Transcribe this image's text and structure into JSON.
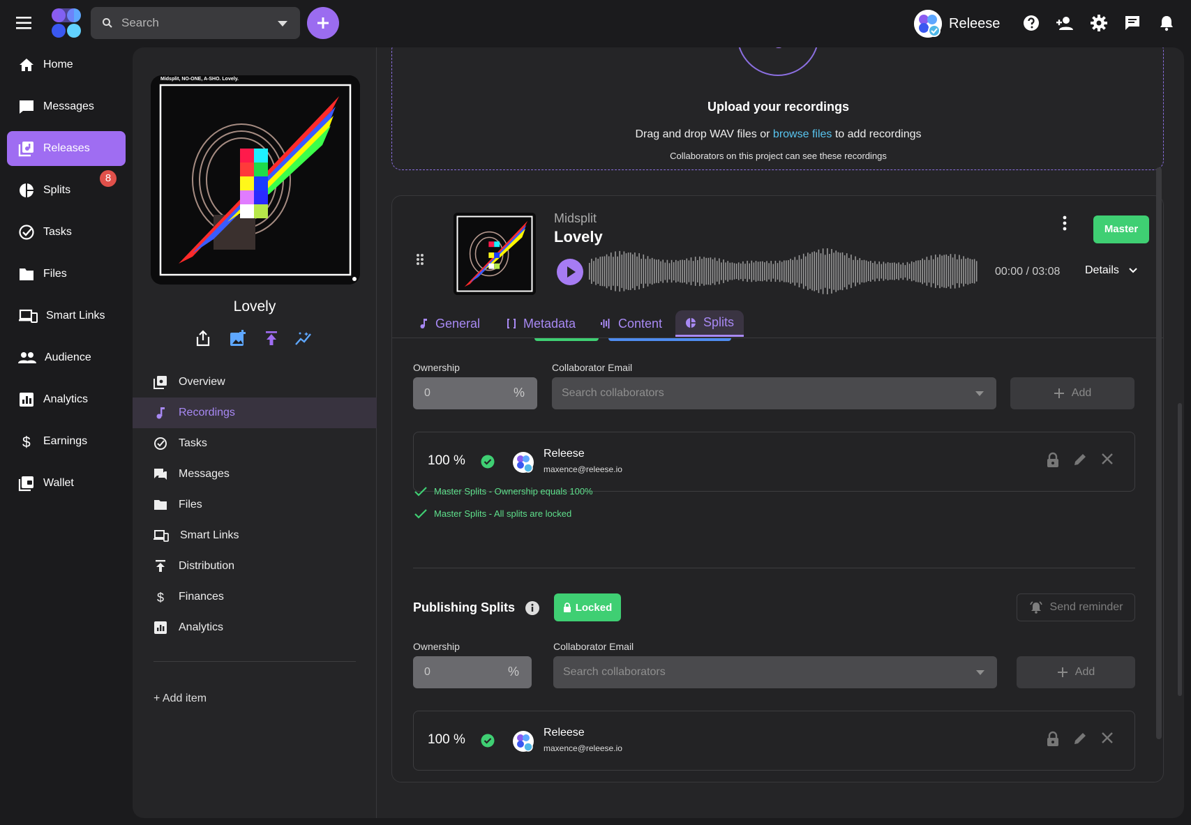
{
  "topbar": {
    "search_placeholder": "Search",
    "user_name": "Releese"
  },
  "sidebar": {
    "items": [
      {
        "label": "Home",
        "icon": "home-icon"
      },
      {
        "label": "Messages",
        "icon": "chat-icon"
      },
      {
        "label": "Releases",
        "icon": "releases-icon",
        "active": true
      },
      {
        "label": "Splits",
        "icon": "pie-chart-icon",
        "badge": "8"
      },
      {
        "label": "Tasks",
        "icon": "check-circle-icon"
      },
      {
        "label": "Files",
        "icon": "folder-icon"
      },
      {
        "label": "Smart Links",
        "icon": "devices-icon"
      },
      {
        "label": "Audience",
        "icon": "people-icon"
      },
      {
        "label": "Analytics",
        "icon": "analytics-icon"
      },
      {
        "label": "Earnings",
        "icon": "dollar-icon"
      },
      {
        "label": "Wallet",
        "icon": "wallet-icon"
      }
    ]
  },
  "release": {
    "title": "Lovely",
    "cover_caption": "Midsplit, NO-ONE, A-SHO. Lovely.",
    "menu": [
      {
        "label": "Overview",
        "icon": "overview-icon"
      },
      {
        "label": "Recordings",
        "icon": "music-note-icon",
        "active": true
      },
      {
        "label": "Tasks",
        "icon": "check-circle-icon"
      },
      {
        "label": "Messages",
        "icon": "chat-icon"
      },
      {
        "label": "Files",
        "icon": "folder-icon"
      },
      {
        "label": "Smart Links",
        "icon": "devices-icon"
      },
      {
        "label": "Distribution",
        "icon": "upload-icon"
      },
      {
        "label": "Finances",
        "icon": "dollar-icon"
      },
      {
        "label": "Analytics",
        "icon": "analytics-icon"
      }
    ],
    "add_item": "+ Add item"
  },
  "upload": {
    "title": "Upload your recordings",
    "desc_before": "Drag and drop WAV files or ",
    "browse_link": "browse files",
    "desc_after": " to add recordings",
    "note": "Collaborators on this project can see these recordings"
  },
  "recording": {
    "artist": "Midsplit",
    "title": "Lovely",
    "time": "00:00 / 03:08",
    "details_label": "Details",
    "master_label": "Master",
    "tabs": [
      "General",
      "Metadata",
      "Content",
      "Splits"
    ],
    "active_tab": "Splits"
  },
  "master_splits": {
    "ownership_label": "Ownership",
    "ownership_value": "0",
    "percent_sign": "%",
    "collaborator_label": "Collaborator Email",
    "collaborator_placeholder": "Search collaborators",
    "add_label": "Add",
    "row": {
      "percent": "100 %",
      "name": "Releese",
      "email": "maxence@releese.io"
    },
    "validations": [
      "Master Splits - Ownership equals 100%",
      "Master Splits - All splits are locked"
    ]
  },
  "publishing_splits": {
    "title": "Publishing Splits",
    "status": "Locked",
    "reminder_label": "Send reminder",
    "ownership_label": "Ownership",
    "ownership_value": "0",
    "percent_sign": "%",
    "collaborator_label": "Collaborator Email",
    "collaborator_placeholder": "Search collaborators",
    "add_label": "Add",
    "row": {
      "percent": "100 %",
      "name": "Releese",
      "email": "maxence@releese.io"
    }
  },
  "colors": {
    "accent": "#9f6df2",
    "success": "#3fcf73",
    "link": "#58c4ef",
    "badge": "#e0504a"
  }
}
